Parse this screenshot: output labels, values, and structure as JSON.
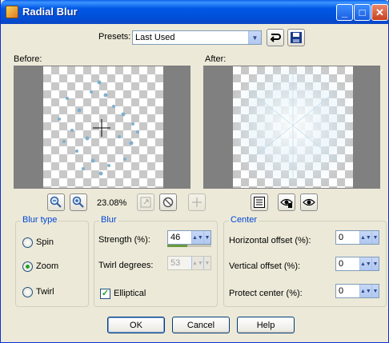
{
  "window": {
    "title": "Radial Blur"
  },
  "titlebar": {
    "minimize": "_",
    "maximize": "□",
    "close": "✕"
  },
  "presets": {
    "label": "Presets:",
    "value": "Last Used"
  },
  "preview": {
    "before_label": "Before:",
    "after_label": "After:",
    "zoom": "23.08%"
  },
  "blur_type": {
    "title": "Blur type",
    "options": [
      {
        "label": "Spin",
        "selected": false
      },
      {
        "label": "Zoom",
        "selected": true
      },
      {
        "label": "Twirl",
        "selected": false
      }
    ]
  },
  "blur": {
    "title": "Blur",
    "strength_label": "Strength (%):",
    "strength_value": "46",
    "strength_fraction": 0.46,
    "twirl_label": "Twirl degrees:",
    "twirl_value": "53",
    "elliptical_label": "Elliptical",
    "elliptical_checked": true
  },
  "center": {
    "title": "Center",
    "horizontal_label": "Horizontal offset (%):",
    "horizontal_value": "0",
    "vertical_label": "Vertical offset (%):",
    "vertical_value": "0",
    "protect_label": "Protect center (%):",
    "protect_value": "0"
  },
  "buttons": {
    "ok": "OK",
    "cancel": "Cancel",
    "help": "Help"
  },
  "colors": {
    "title_bar": "#0054e3",
    "group_title": "#0046d5",
    "dialog_bg": "#ece9d8"
  }
}
